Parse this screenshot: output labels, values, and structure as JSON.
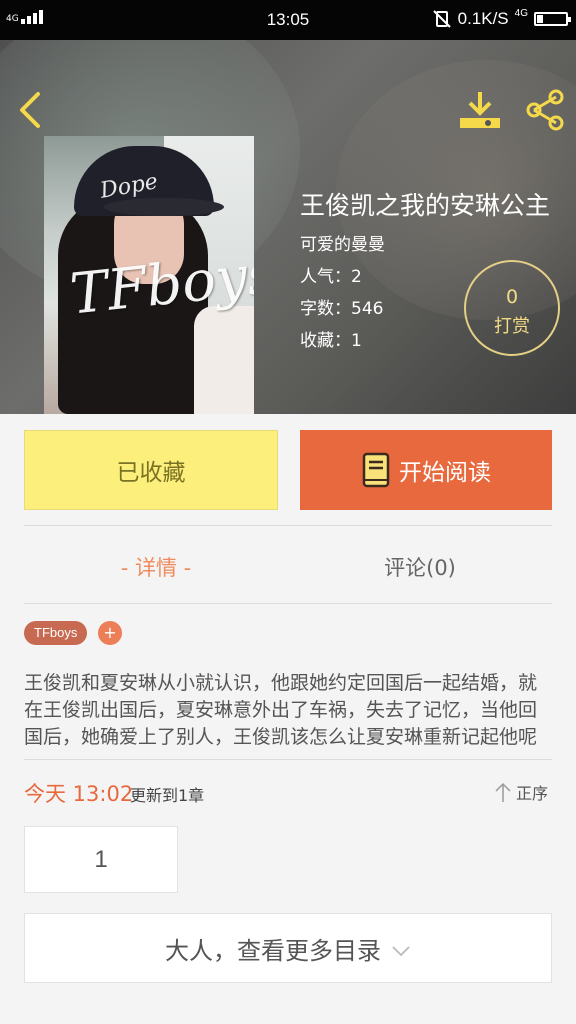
{
  "status_bar": {
    "network_left": "4G",
    "time": "13:05",
    "speed": "0.1K/S",
    "network_right": "4G"
  },
  "book": {
    "cover_text_cap": "Dope",
    "cover_text_logo": "TFboys",
    "title": "王俊凯之我的安琳公主",
    "author": "可爱的曼曼",
    "popularity": "人气：2",
    "word_count": "字数：546",
    "favorites": "收藏：1"
  },
  "tip": {
    "count": "0",
    "label": "打赏"
  },
  "actions": {
    "favorited_label": "已收藏",
    "start_reading_label": "开始阅读"
  },
  "tabs": {
    "details": "- 详情 -",
    "comments": "评论(0)"
  },
  "tags": {
    "items": [
      "TFboys"
    ],
    "add": "+"
  },
  "description": "王俊凯和夏安琳从小就认识，他跟她约定回国后一起结婚，就在王俊凯出国后，夏安琳意外出了车祸，失去了记忆，当他回国后，她确爱上了别人，王俊凯该怎么让夏安琳重新记起他呢",
  "update": {
    "time": "今天 13:02",
    "text": "更新到1章",
    "sort_label": "正序"
  },
  "chapters": [
    "1"
  ],
  "more_catalog": "大人，查看更多目录",
  "colors": {
    "accent_orange": "#e8693e",
    "favorite_yellow": "#fdef7b",
    "tip_gold": "#f2dc84"
  }
}
